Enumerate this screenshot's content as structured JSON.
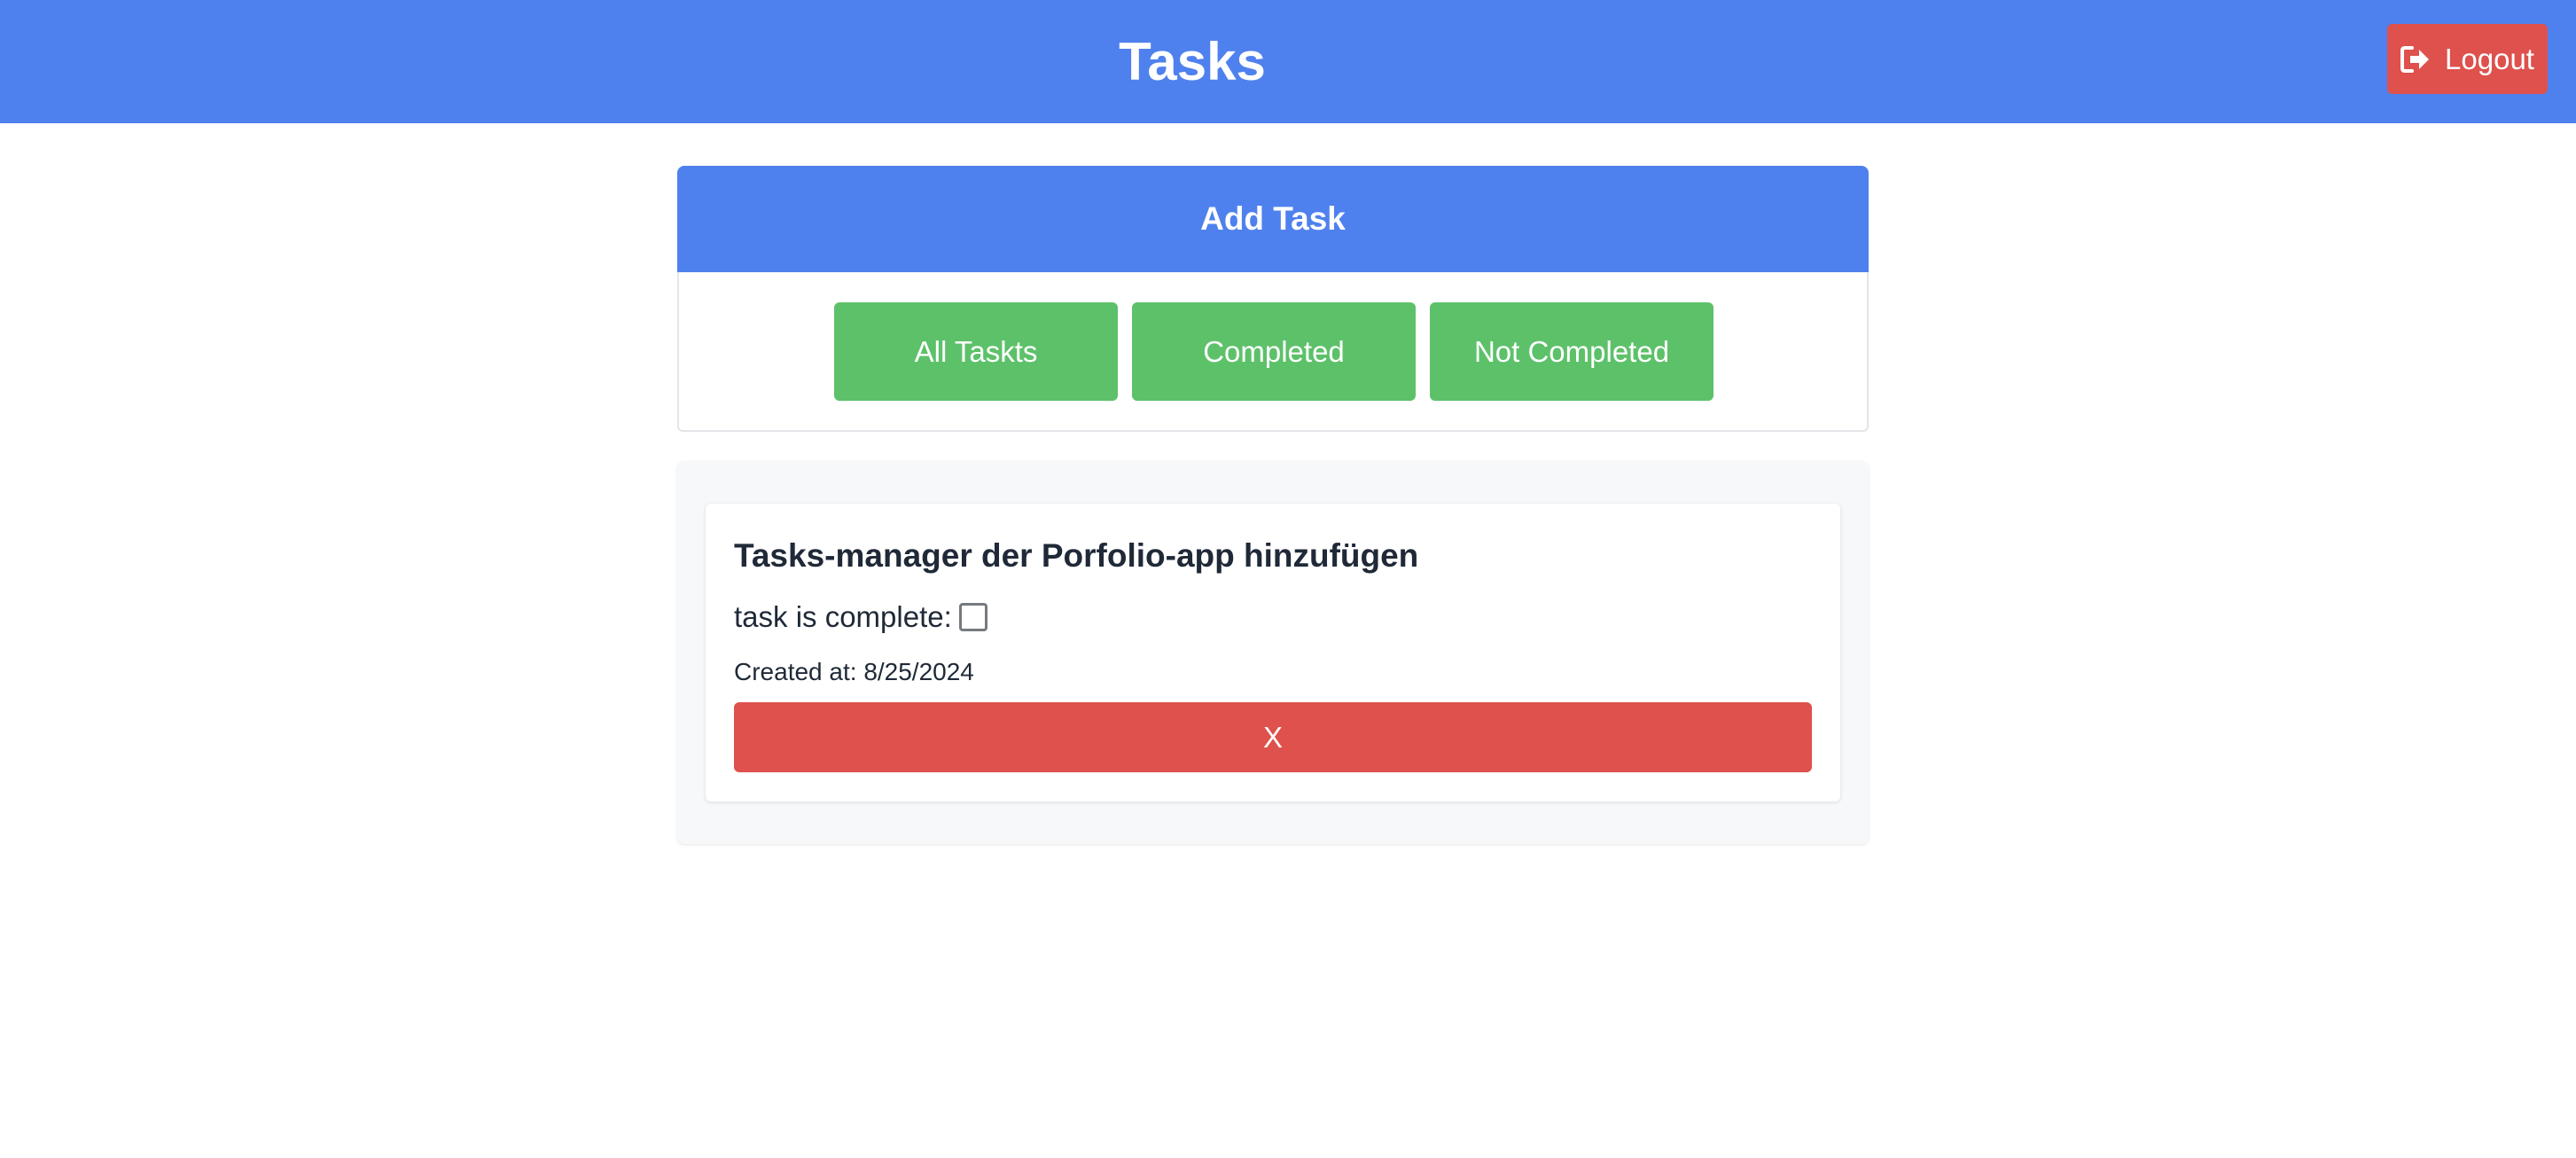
{
  "header": {
    "title": "Tasks",
    "logout_label": "Logout",
    "logout_icon": "logout-icon"
  },
  "add_task": {
    "label": "Add Task"
  },
  "filters": {
    "all_label": "All Taskts",
    "completed_label": "Completed",
    "not_completed_label": "Not Completed"
  },
  "tasks": [
    {
      "title": "Tasks-manager der Porfolio-app hinzufügen",
      "complete_label": "task is complete:",
      "complete": false,
      "created_label": "Created at:",
      "created_date": "8/25/2024",
      "delete_label": "X"
    }
  ],
  "colors": {
    "primary": "#4f81ee",
    "success": "#5dc16a",
    "danger": "#de514d",
    "panel_bg": "#f7f8fa"
  }
}
